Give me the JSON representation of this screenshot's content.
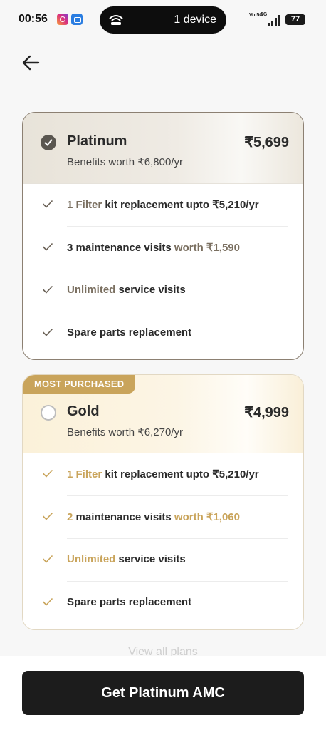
{
  "status_bar": {
    "time": "00:56",
    "pill_text": "1 device",
    "network_label": "Vo 5G",
    "network_type": "5G",
    "battery": "77",
    "icons": [
      "instagram-icon",
      "gallery-icon",
      "hotspot-icon",
      "signal-icon",
      "battery-icon"
    ]
  },
  "nav": {
    "back_icon": "arrow-left-icon"
  },
  "plans": [
    {
      "name": "Platinum",
      "price": "₹5,699",
      "subtitle": "Benefits worth ₹6,800/yr",
      "selected": true,
      "benefits": [
        {
          "highlight": "1 Filter",
          "rest": " kit replacement upto ₹5,210/yr"
        },
        {
          "prefix": "3 maintenance visits ",
          "highlight": "worth ₹1,590"
        },
        {
          "highlight": "Unlimited",
          "rest": " service visits"
        },
        {
          "rest": "Spare parts replacement"
        }
      ]
    },
    {
      "badge": "MOST PURCHASED",
      "name": "Gold",
      "price": "₹4,999",
      "subtitle": "Benefits worth ₹6,270/yr",
      "selected": false,
      "benefits": [
        {
          "highlight": "1 Filter",
          "rest": " kit replacement upto ₹5,210/yr"
        },
        {
          "highlight": "2",
          "rest": " maintenance visits ",
          "highlight2": "worth ₹1,060"
        },
        {
          "highlight": "Unlimited",
          "rest": " service visits"
        },
        {
          "rest": "Spare parts replacement"
        }
      ]
    }
  ],
  "view_all": "View all plans",
  "cta": "Get Platinum AMC",
  "colors": {
    "accent_gold": "#c9a45b",
    "platinum_accent": "#7a6f60",
    "cta_bg": "#1c1c1c"
  }
}
